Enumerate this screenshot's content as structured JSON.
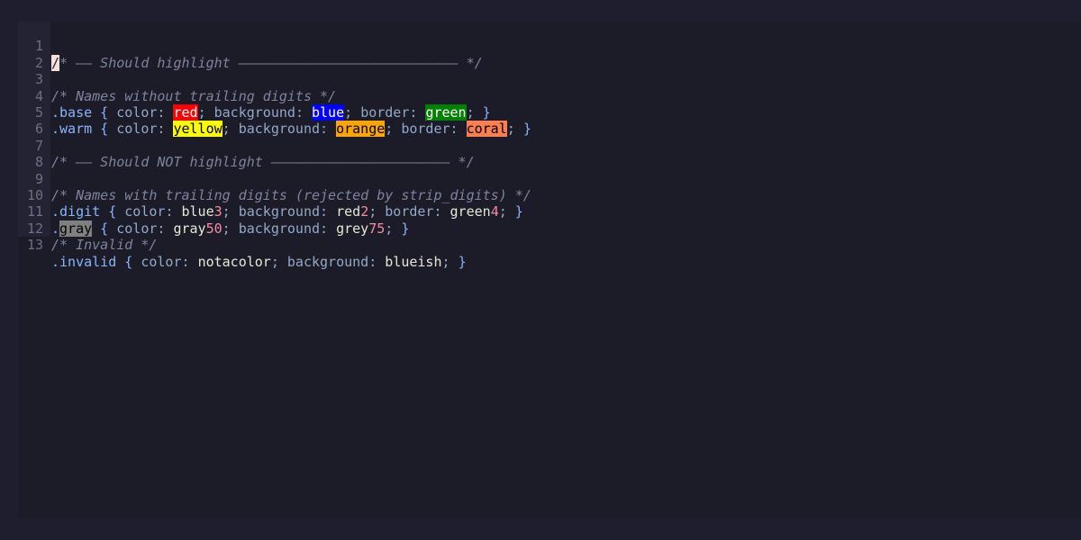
{
  "editor": {
    "lines": [
      {
        "n": "1",
        "cursor_char": "/",
        "comment": "* —— Should highlight ——————————————————————————— */"
      },
      {
        "n": "2"
      },
      {
        "n": "3",
        "comment": "/* Names without trailing digits */"
      },
      {
        "n": "4",
        "selector": ".base",
        "open": " { ",
        "prop1": "color",
        "sep1": ": ",
        "val1": "red",
        "semi1": "; ",
        "prop2": "background",
        "sep2": ": ",
        "val2": "blue",
        "semi2": "; ",
        "prop3": "border",
        "sep3": ": ",
        "val3": "green",
        "semi3": "; ",
        "close": "}"
      },
      {
        "n": "5",
        "selector": ".warm",
        "open": " { ",
        "prop1": "color",
        "sep1": ": ",
        "val1": "yellow",
        "semi1": "; ",
        "prop2": "background",
        "sep2": ": ",
        "val2": "orange",
        "semi2": "; ",
        "prop3": "border",
        "sep3": ": ",
        "val3": "coral",
        "semi3": "; ",
        "close": "}"
      },
      {
        "n": "6"
      },
      {
        "n": "7",
        "comment": "/* —— Should NOT highlight —————————————————————— */"
      },
      {
        "n": "8"
      },
      {
        "n": "9",
        "comment": "/* Names with trailing digits (rejected by strip_digits) */"
      },
      {
        "n": "10",
        "selector": ".digit",
        "open": " { ",
        "prop1": "color",
        "sep1": ": ",
        "val1a": "blue",
        "val1b": "3",
        "semi1": "; ",
        "prop2": "background",
        "sep2": ": ",
        "val2a": "red",
        "val2b": "2",
        "semi2": "; ",
        "prop3": "border",
        "sep3": ": ",
        "val3a": "green",
        "val3b": "4",
        "semi3": "; ",
        "close": "}"
      },
      {
        "n": "11",
        "dot": ".",
        "gray": "gray",
        "open": " { ",
        "prop1": "color",
        "sep1": ": ",
        "val1a": "gray",
        "val1b": "50",
        "semi1": "; ",
        "prop2": "background",
        "sep2": ": ",
        "val2a": "grey",
        "val2b": "75",
        "semi2": "; ",
        "close": "}"
      },
      {
        "n": "12",
        "comment": "/* Invalid */"
      },
      {
        "n": "13",
        "selector": ".invalid",
        "open": " { ",
        "prop1": "color",
        "sep1": ": ",
        "val1": "notacolor",
        "semi1": "; ",
        "prop2": "background",
        "sep2": ": ",
        "val2": "blueish",
        "semi2": "; ",
        "close": "}"
      }
    ]
  },
  "colors": {
    "background": "#1e1e2e",
    "comment": "#7f849c",
    "selector": "#89b4fa",
    "number": "#f38ba8",
    "swatch_red": "#ff0000",
    "swatch_blue": "#0000ff",
    "swatch_green": "#008000",
    "swatch_yellow": "#ffff00",
    "swatch_orange": "#ffa500",
    "swatch_coral": "#ff7f50",
    "swatch_gray": "#808080"
  }
}
